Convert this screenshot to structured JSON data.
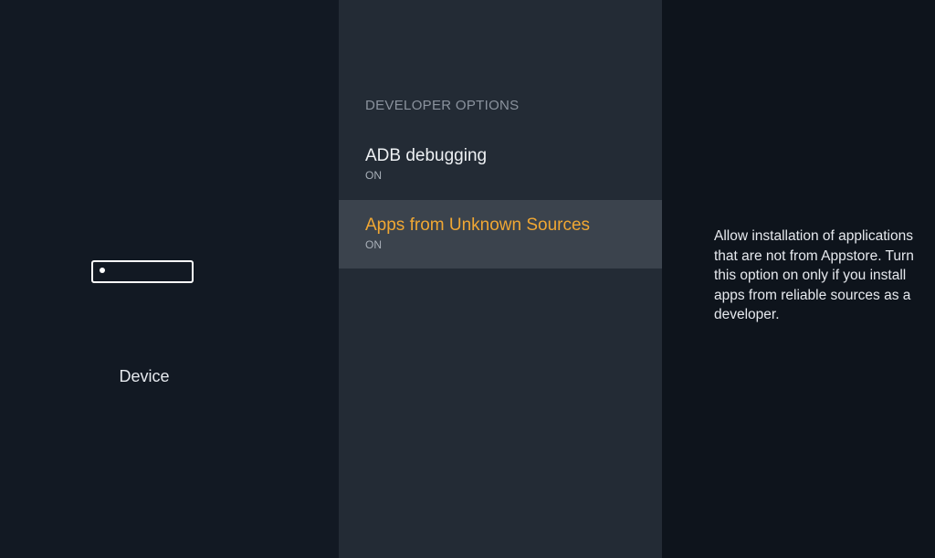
{
  "left_panel": {
    "category_label": "Device"
  },
  "middle_panel": {
    "section_header": "DEVELOPER OPTIONS",
    "items": [
      {
        "title": "ADB debugging",
        "value": "ON",
        "selected": false
      },
      {
        "title": "Apps from Unknown Sources",
        "value": "ON",
        "selected": true
      }
    ]
  },
  "right_panel": {
    "description": "Allow installation of applications that are not from Appstore. Turn this option on only if you install apps from reliable sources as a developer."
  },
  "colors": {
    "background_left": "#121923",
    "background_middle": "#232b35",
    "background_right": "#0e141c",
    "selected_item_background": "#3b434d",
    "selected_item_text": "#f0a733"
  },
  "icons": {
    "device": "device-icon"
  }
}
